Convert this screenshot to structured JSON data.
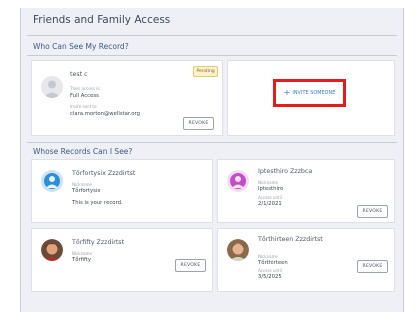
{
  "page": {
    "title": "Friends and Family Access"
  },
  "who_can_see": {
    "heading": "Who Can See My Record?",
    "card": {
      "name": "test c",
      "badge": "Pending",
      "access_label": "Their access is:",
      "access_value": "Full Access",
      "invite_label": "Invite sent to:",
      "invite_value": "clara.morton@wellstar.org",
      "revoke_label": "REVOKE"
    },
    "invite": {
      "label": "INVITE SOMEONE",
      "plus": "+"
    }
  },
  "whose_records": {
    "heading": "Whose Records Can I See?",
    "cards": [
      {
        "name": "Tőrfortysix Zzzdirtst",
        "nickname_label": "Nickname",
        "nickname": "Tőrfortysix",
        "note": "This is your record."
      },
      {
        "name": "Iptesthiro Zzzbca",
        "nickname_label": "Nickname",
        "nickname": "Iptesthiro",
        "access_label": "Access until",
        "access_until": "2/1/2021",
        "revoke_label": "REVOKE"
      },
      {
        "name": "Tőrfifty Zzzdirtst",
        "nickname_label": "Nickname",
        "nickname": "Tőrfifty",
        "revoke_label": "REVOKE"
      },
      {
        "name": "Tőrthirteen Zzzdirtst",
        "nickname_label": "Nickname",
        "nickname": "Tőrthirteen",
        "access_label": "Access until",
        "access_until": "3/5/2025",
        "revoke_label": "REVOKE"
      }
    ]
  },
  "colors": {
    "invite_highlight": "#e11d1d",
    "link_blue": "#3477c4",
    "pending_bg": "#fbf1cc",
    "panel_bg": "#eef0f5"
  }
}
